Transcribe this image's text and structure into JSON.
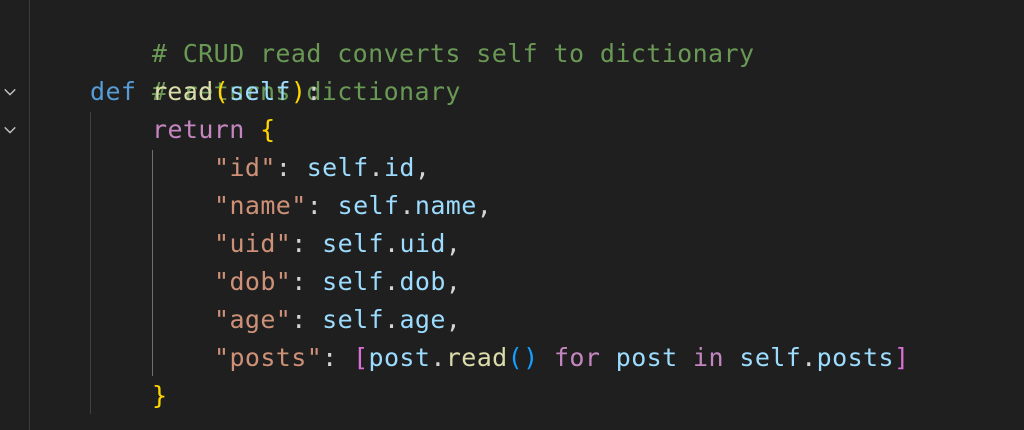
{
  "editor": {
    "language": "python",
    "theme_colors": {
      "background": "#1f1f1f",
      "comment": "#6a9955",
      "keyword": "#569cd6",
      "control_keyword": "#c586c0",
      "function": "#dcdcaa",
      "variable": "#9cdcfe",
      "string": "#ce9178",
      "bracket_level1": "#ffd700",
      "bracket_level2": "#da70d6",
      "bracket_level3": "#179fff"
    },
    "folding_icons": [
      "chevron-down-icon",
      "chevron-down-icon"
    ],
    "lines": {
      "l1": {
        "comment": "# CRUD read converts self to dictionary"
      },
      "l2": {
        "comment": "# returns dictionary"
      },
      "l3": {
        "def": "def",
        "name": "read",
        "open": "(",
        "param": "self",
        "close": ")",
        "colon": ":"
      },
      "l4": {
        "return": "return",
        "brace": "{"
      },
      "l5": {
        "key": "\"id\"",
        "colon": ": ",
        "obj": "self",
        "dot": ".",
        "attr": "id",
        "comma": ","
      },
      "l6": {
        "key": "\"name\"",
        "colon": ": ",
        "obj": "self",
        "dot": ".",
        "attr": "name",
        "comma": ","
      },
      "l7": {
        "key": "\"uid\"",
        "colon": ": ",
        "obj": "self",
        "dot": ".",
        "attr": "uid",
        "comma": ","
      },
      "l8": {
        "key": "\"dob\"",
        "colon": ": ",
        "obj": "self",
        "dot": ".",
        "attr": "dob",
        "comma": ","
      },
      "l9": {
        "key": "\"age\"",
        "colon": ": ",
        "obj": "self",
        "dot": ".",
        "attr": "age",
        "comma": ","
      },
      "l10": {
        "key": "\"posts\"",
        "colon": ": ",
        "lbr": "[",
        "post1": "post",
        "dot1": ".",
        "method": "read",
        "lp": "(",
        "rp": ")",
        "for": "for",
        "post2": "post",
        "in": "in",
        "obj": "self",
        "dot2": ".",
        "attr": "posts",
        "rbr": "]"
      },
      "l11": {
        "brace": "}"
      }
    }
  }
}
